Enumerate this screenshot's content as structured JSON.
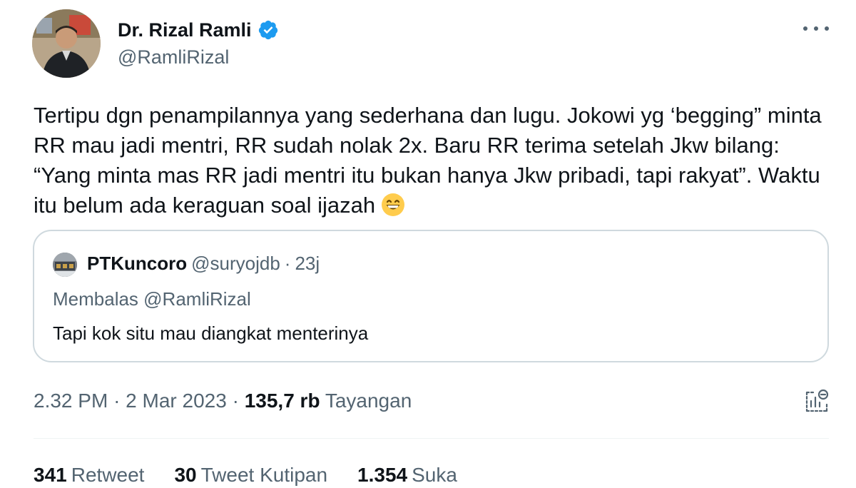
{
  "author": {
    "name": "Dr. Rizal Ramli",
    "handle": "@RamliRizal",
    "verified": true
  },
  "tweet": {
    "text": "Tertipu dgn penampilannya yang sederhana dan lugu. Jokowi yg ‘begging” minta RR mau jadi mentri, RR sudah nolak 2x. Baru RR terima setelah Jkw bilang: “Yang minta mas RR jadi mentri itu bukan hanya Jkw pribadi, tapi rakyat”. Waktu itu belum ada keraguan soal ijazah",
    "emoji": "grinning-face-with-smiling-eyes"
  },
  "quote": {
    "name": "PTKuncoro",
    "handle": "@suryojdb",
    "time_sep": "·",
    "time": "23j",
    "reply_label": "Membalas @RamliRizal",
    "text": "Tapi kok situ mau diangkat menterinya"
  },
  "meta": {
    "time": "2.32 PM",
    "sep1": "·",
    "date": "2 Mar 2023",
    "sep2": "·",
    "views_count": "135,7 rb",
    "views_label": "Tayangan"
  },
  "stats": {
    "retweets_count": "341",
    "retweets_label": "Retweet",
    "quotes_count": "30",
    "quotes_label": "Tweet Kutipan",
    "likes_count": "1.354",
    "likes_label": "Suka"
  },
  "colors": {
    "accent": "#1d9bf0",
    "text": "#0f1419",
    "secondary": "#536471",
    "border": "#cfd9de"
  },
  "icons": {
    "verified": "verified-badge-icon",
    "more": "more-icon",
    "analytics": "analytics-icon"
  }
}
